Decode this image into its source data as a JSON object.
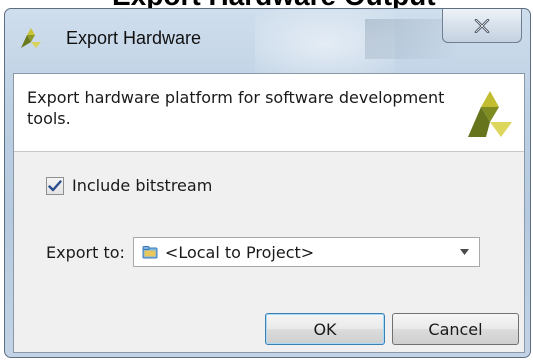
{
  "window": {
    "title": "Export Hardware",
    "cropped_heading": "Export Hardware Output"
  },
  "header": {
    "description": "Export hardware platform for software development tools."
  },
  "options": {
    "include_bitstream_label": "Include bitstream",
    "include_bitstream_checked": true,
    "export_to_label": "Export to:",
    "export_to_value": "<Local to Project>"
  },
  "buttons": {
    "ok_label": "OK",
    "cancel_label": "Cancel"
  },
  "colors": {
    "logo_dark": "#6b7a1e",
    "logo_light": "#d6d65a",
    "accent": "#3c7fb1"
  },
  "icons": {
    "title": "vivado-logo-icon",
    "close": "close-icon",
    "checkbox": "checkmark-icon",
    "combo": "folder-icon",
    "dropdown": "chevron-down-icon"
  }
}
